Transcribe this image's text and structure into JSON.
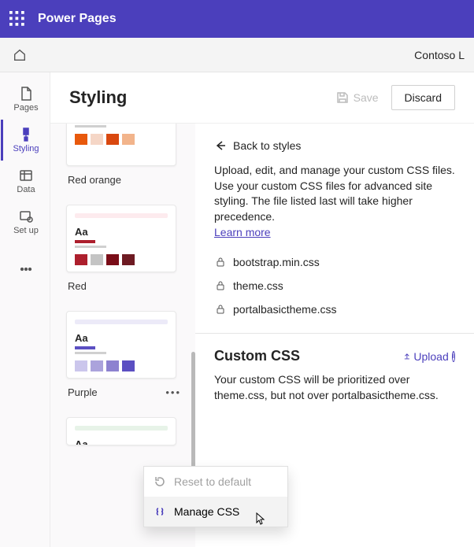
{
  "appbar": {
    "product": "Power Pages"
  },
  "cmdbar": {
    "tenant": "Contoso L"
  },
  "nav": {
    "items": [
      {
        "id": "pages",
        "label": "Pages"
      },
      {
        "id": "styling",
        "label": "Styling"
      },
      {
        "id": "data",
        "label": "Data"
      },
      {
        "id": "setup",
        "label": "Set up"
      }
    ]
  },
  "page": {
    "title": "Styling",
    "save_label": "Save",
    "discard_label": "Discard"
  },
  "themes": [
    {
      "id": "red-orange",
      "label": "Red orange",
      "topbar": "#fde7da",
      "accent": "#e8590c",
      "swatches": [
        "#e8590c",
        "#f5d6c6",
        "#d9480f",
        "#f2b48b"
      ]
    },
    {
      "id": "red",
      "label": "Red",
      "topbar": "#fdebee",
      "accent": "#ad1f2d",
      "swatches": [
        "#ad1f2d",
        "#c4c4c4",
        "#7a0d18",
        "#6e1b23"
      ]
    },
    {
      "id": "purple",
      "label": "Purple",
      "topbar": "#eceaf8",
      "accent": "#5b4fc2",
      "swatches": [
        "#cbc6ec",
        "#aba3dc",
        "#8d82d0",
        "#5b4fc2"
      ]
    },
    {
      "id": "green-partial",
      "label": "",
      "topbar": "#e7f3e8",
      "accent": "#2d8a3e",
      "swatches": []
    }
  ],
  "detail": {
    "back_label": "Back to styles",
    "description": "Upload, edit, and manage your custom CSS files. Use your custom CSS files for advanced site styling. The file listed last will take higher precedence.",
    "learn_more": "Learn more",
    "files": [
      {
        "name": "bootstrap.min.css",
        "locked": true
      },
      {
        "name": "theme.css",
        "locked": true
      },
      {
        "name": "portalbasictheme.css",
        "locked": true
      }
    ],
    "custom_section": {
      "heading": "Custom CSS",
      "upload_label": "Upload",
      "description": "Your custom CSS will be prioritized over theme.css, but not over portalbasictheme.css."
    }
  },
  "ctx_menu": {
    "reset_label": "Reset to default",
    "manage_label": "Manage CSS"
  }
}
